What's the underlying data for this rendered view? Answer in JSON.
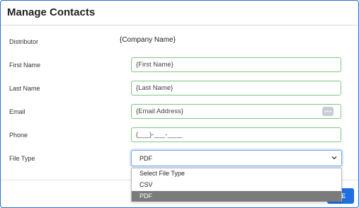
{
  "dialog": {
    "title": "Manage Contacts"
  },
  "fields": {
    "distributor_label": "Distributor",
    "distributor_value": "{Company Name}",
    "first_name_label": "First Name",
    "first_name_placeholder": "{First Name}",
    "last_name_label": "Last Name",
    "last_name_placeholder": "{Last Name}",
    "email_label": "Email",
    "email_placeholder": "{Email Address}",
    "phone_label": "Phone",
    "phone_placeholder": "(___)-___-____",
    "file_type_label": "File Type",
    "file_type_selected": "PDF"
  },
  "dropdown": {
    "options": [
      "Select File Type",
      "CSV",
      "PDF"
    ],
    "highlighted": "PDF"
  },
  "footer": {
    "save_label": "VE"
  },
  "icons": {
    "email_extension": "more-dots-icon",
    "select_arrow": "chevron-down-icon"
  },
  "colors": {
    "valid_border": "#7fc77f",
    "focus_border": "#7aa9e8",
    "primary": "#1f6fe0"
  }
}
